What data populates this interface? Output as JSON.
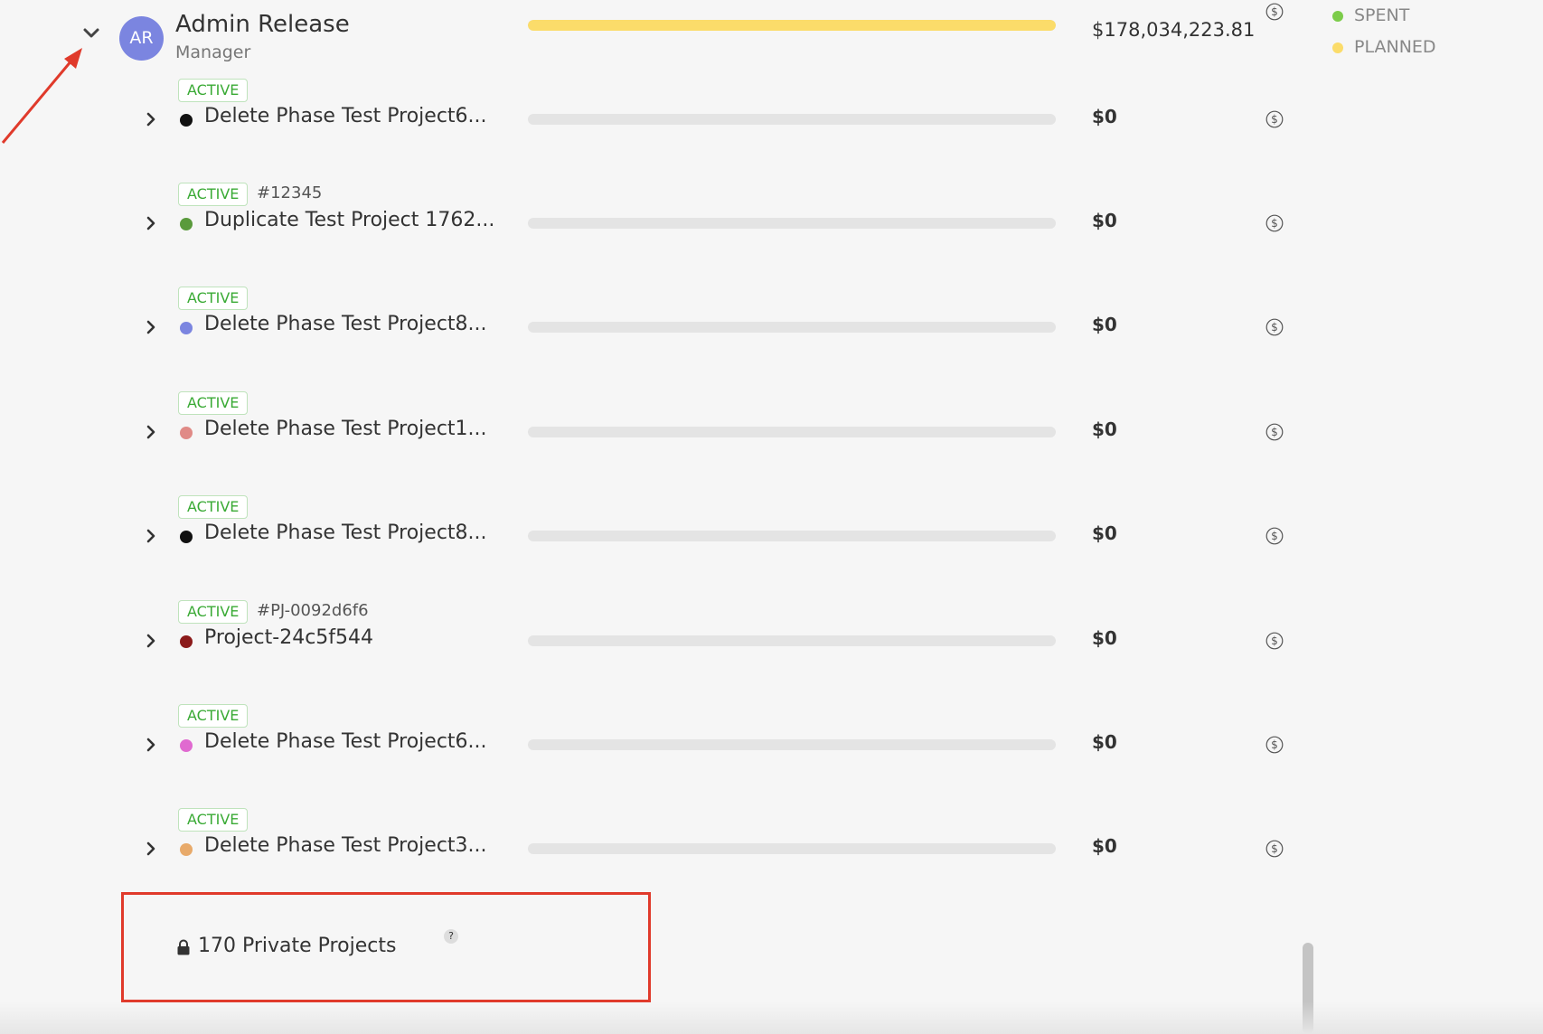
{
  "owner": {
    "initials": "AR",
    "name": "Admin Release",
    "role": "Manager",
    "total_amount": "$178,034,223.81",
    "spent_fraction": 0,
    "planned_fraction": 1.0
  },
  "legend": {
    "spent_label": "SPENT",
    "planned_label": "PLANNED",
    "spent_color": "#7ccc4a",
    "planned_color": "#fbdc6a"
  },
  "projects": [
    {
      "status": "ACTIVE",
      "number": "",
      "name": "Delete Phase Test Project6...",
      "dot_color": "#111111",
      "amount": "$0",
      "spent_fraction": 0
    },
    {
      "status": "ACTIVE",
      "number": "#12345",
      "name": "Duplicate Test Project 1762...",
      "dot_color": "#5a9a3c",
      "amount": "$0",
      "spent_fraction": 0
    },
    {
      "status": "ACTIVE",
      "number": "",
      "name": "Delete Phase Test Project8...",
      "dot_color": "#7b85e0",
      "amount": "$0",
      "spent_fraction": 0
    },
    {
      "status": "ACTIVE",
      "number": "",
      "name": "Delete Phase Test Project1...",
      "dot_color": "#e08a86",
      "amount": "$0",
      "spent_fraction": 0
    },
    {
      "status": "ACTIVE",
      "number": "",
      "name": "Delete Phase Test Project8...",
      "dot_color": "#111111",
      "amount": "$0",
      "spent_fraction": 0
    },
    {
      "status": "ACTIVE",
      "number": "#PJ-0092d6f6",
      "name": "Project-24c5f544",
      "dot_color": "#8b1a1a",
      "amount": "$0",
      "spent_fraction": 0
    },
    {
      "status": "ACTIVE",
      "number": "",
      "name": "Delete Phase Test Project6...",
      "dot_color": "#e06ad0",
      "amount": "$0",
      "spent_fraction": 0
    },
    {
      "status": "ACTIVE",
      "number": "",
      "name": "Delete Phase Test Project3...",
      "dot_color": "#e8aa6a",
      "amount": "$0",
      "spent_fraction": 0
    }
  ],
  "private_projects": {
    "label": "170 Private Projects",
    "help_glyph": "?"
  },
  "icons": {
    "collapse": "chevron-down-icon",
    "expand": "chevron-right-icon",
    "budget": "dollar-circle-icon",
    "lock": "lock-icon",
    "help": "help-icon"
  },
  "annotation_color": "#e03a2b"
}
